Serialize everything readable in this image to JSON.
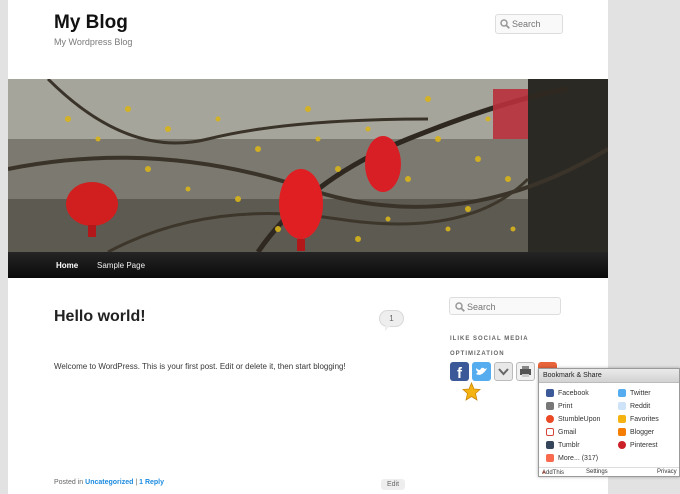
{
  "site": {
    "title": "My Blog",
    "description": "My Wordpress Blog"
  },
  "header_search": {
    "placeholder": "Search"
  },
  "nav": {
    "items": [
      {
        "label": "Home"
      },
      {
        "label": "Sample Page"
      }
    ]
  },
  "post": {
    "title": "Hello world!",
    "comment_count": "1",
    "body": "Welcome to WordPress. This is your first post. Edit or delete it, then start blogging!",
    "footer": {
      "posted_in": "Posted in",
      "category": "Uncategorized",
      "sep": "|",
      "reply": "1 Reply",
      "edit": "Edit"
    }
  },
  "sidebar": {
    "search_placeholder": "Search",
    "widget_title_line1": "ILIKE SOCIAL MEDIA",
    "widget_title_line2": "OPTIMIZATION",
    "icons": [
      "facebook-icon",
      "twitter-icon",
      "delicious-icon",
      "print-icon",
      "addthis-icon",
      "favorites-icon"
    ]
  },
  "bookmark_popup": {
    "title": "Bookmark & Share",
    "left_items": [
      "Facebook",
      "Print",
      "StumbleUpon",
      "Gmail",
      "Tumblr",
      "More... (317)"
    ],
    "right_items": [
      "Twitter",
      "Reddit",
      "Favorites",
      "Blogger",
      "Pinterest"
    ],
    "footer": {
      "brand": "AddThis",
      "settings": "Settings",
      "privacy": "Privacy"
    }
  },
  "colors": {
    "link": "#1b8be0",
    "nav_bg": "#1a1a1a",
    "page_bg": "#e2e2e2"
  }
}
